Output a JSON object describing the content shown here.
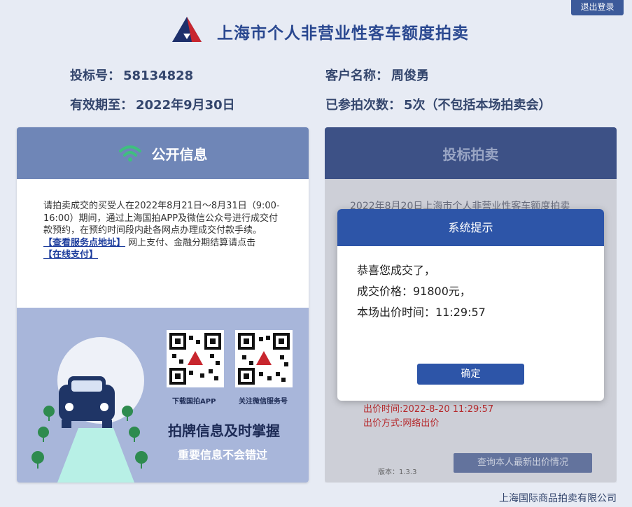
{
  "logout_label": "退出登录",
  "site_title": "上海市个人非营业性客车额度拍卖",
  "info": {
    "bid_no_label": "投标号：",
    "bid_no": "58134828",
    "customer_label": "客户名称：",
    "customer": "周俊勇",
    "valid_label": "有效期至：",
    "valid": "2022年9月30日",
    "count_label": "已参拍次数：",
    "count": "5次（不包括本场拍卖会）"
  },
  "public_info": {
    "title": "公开信息",
    "notice": "请拍卖成交的买受人在2022年8月21日～8月31日（9:00-16:00）期间，通过上海国拍APP及微信公众号进行成交付款预约，在预约时间段内赴各网点办理成交付款手续。",
    "service_link": "【查看服务点地址】",
    "pay_text": "网上支付、金融分期结算请点击",
    "pay_link": "【在线支付】",
    "qr_app_caption": "下载国拍APP",
    "qr_wechat_caption": "关注微信服务号",
    "slogan_main": "拍牌信息及时掌握",
    "slogan_sub": "重要信息不会错过"
  },
  "bidding": {
    "title": "投标拍卖",
    "auction_title": "2022年8月20日上海市个人非营业性客车额度拍卖",
    "bid_time": "出价时间:2022-8-20 11:29:57",
    "bid_method": "出价方式:网络出价",
    "version": "版本：1.3.3",
    "query_button": "查询本人最新出价情况"
  },
  "dialog": {
    "title": "系统提示",
    "line1": "恭喜您成交了，",
    "line2": "成交价格：91800元，",
    "line3": "本场出价时间：11:29:57",
    "ok_button": "确定"
  },
  "footer": "上海国际商品拍卖有限公司",
  "colors": {
    "brand_blue": "#2d55a8",
    "header_blue": "#6f86b7",
    "wifi_green": "#3fbf7f",
    "alert_red": "#c0282a"
  },
  "icons": [
    "logo-triangle-icon",
    "wifi-icon",
    "qr-code-icon",
    "car-illustration-icon"
  ]
}
